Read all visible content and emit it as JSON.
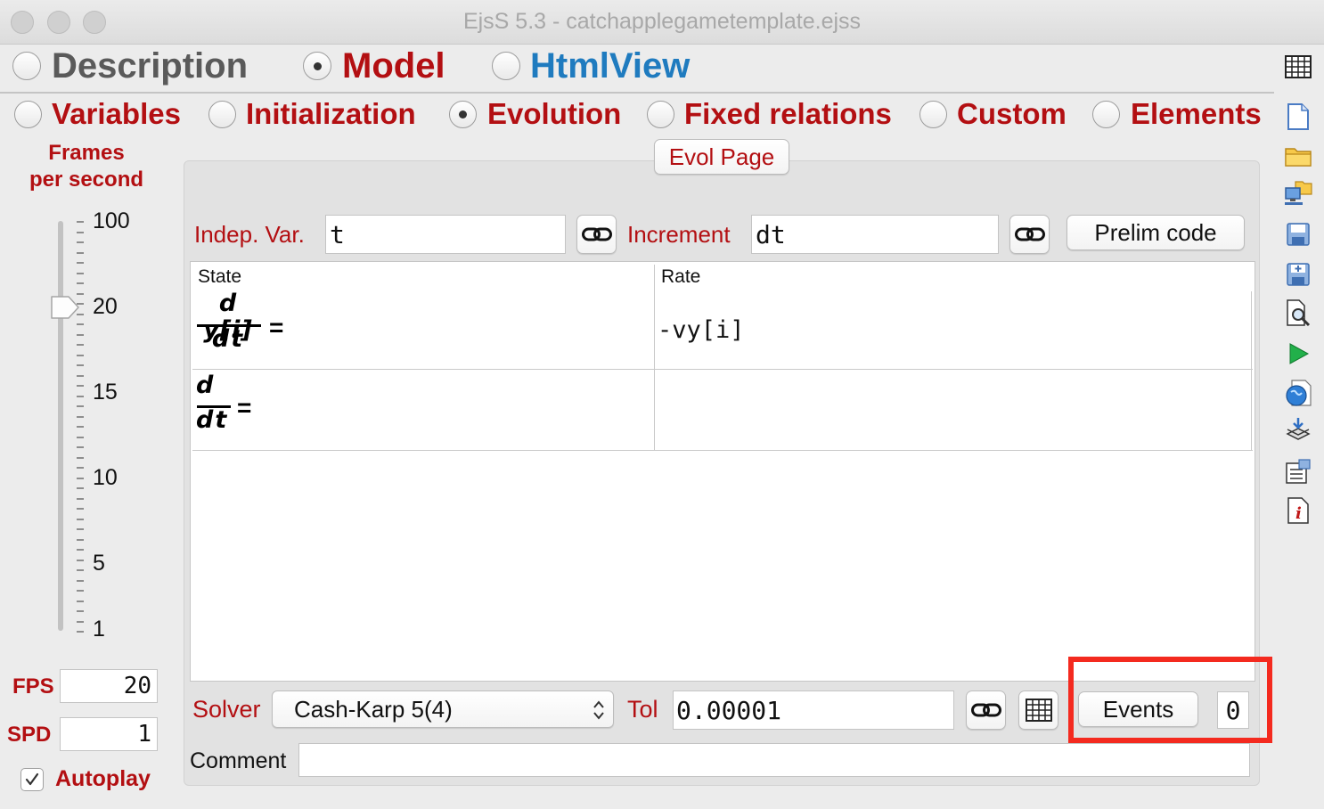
{
  "window": {
    "title": "EjsS 5.3 - catchapplegametemplate.ejss"
  },
  "main_tabs": [
    {
      "label": "Description",
      "selected": false,
      "color": "#5a5a5a"
    },
    {
      "label": "Model",
      "selected": true,
      "color": "#b30f12"
    },
    {
      "label": "HtmlView",
      "selected": false,
      "color": "#1f7bbf"
    }
  ],
  "model_tabs": [
    {
      "label": "Variables",
      "selected": false
    },
    {
      "label": "Initialization",
      "selected": false
    },
    {
      "label": "Evolution",
      "selected": true
    },
    {
      "label": "Fixed relations",
      "selected": false
    },
    {
      "label": "Custom",
      "selected": false
    },
    {
      "label": "Elements",
      "selected": false
    }
  ],
  "sidebar": {
    "frames_label_1": "Frames",
    "frames_label_2": "per second",
    "slider_ticks": [
      "100",
      "20",
      "15",
      "10",
      "5",
      "1"
    ],
    "slider_value": 20,
    "fps_label": "FPS",
    "fps_value": "20",
    "spd_label": "SPD",
    "spd_value": "1",
    "autoplay_label": "Autoplay",
    "autoplay_checked": true
  },
  "page": {
    "tab_label": "Evol Page",
    "indep_var_label": "Indep. Var.",
    "indep_var_value": "t",
    "increment_label": "Increment",
    "increment_value": "dt",
    "prelim_button": "Prelim code",
    "table": {
      "headers": [
        "State",
        "Rate"
      ],
      "rows": [
        {
          "state_num": "d y[i]",
          "state_den": "dt",
          "rate": "-vy[i]"
        },
        {
          "state_num": "d",
          "state_den": "dt",
          "rate": ""
        }
      ]
    },
    "solver_label": "Solver",
    "solver_value": "Cash-Karp 5(4)",
    "tol_label": "Tol",
    "tol_value": "0.00001",
    "events_button": "Events",
    "events_count": "0",
    "comment_label": "Comment",
    "comment_value": ""
  },
  "highlight": {
    "target": "events-button",
    "color": "#f42a1f"
  },
  "toolbar_icons": [
    "new-file-icon",
    "open-folder-icon",
    "open-network-icon",
    "save-icon",
    "save-as-icon",
    "search-icon",
    "run-icon",
    "web-icon",
    "download-icon",
    "options-icon",
    "info-icon"
  ]
}
